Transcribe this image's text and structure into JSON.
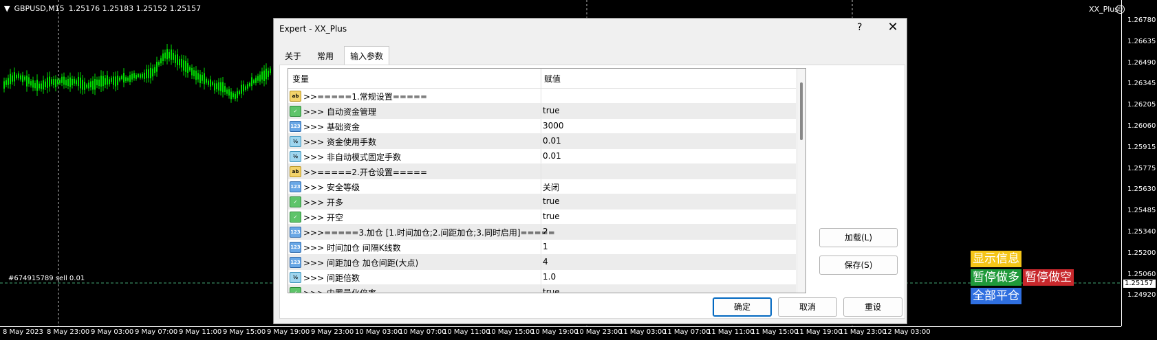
{
  "chart": {
    "symbol": "GBPUSD,M15",
    "ohlc": "1.25176 1.25183 1.25152 1.25157",
    "ea_name": "XX_Plus",
    "order_label": "#674915789 sell 0.01",
    "current_price": "1.25157",
    "price_ticks": [
      "1.26780",
      "1.26635",
      "1.26490",
      "1.26345",
      "1.26205",
      "1.26060",
      "1.25915",
      "1.25775",
      "1.25630",
      "1.25485",
      "1.25340",
      "1.25200",
      "1.25060",
      "1.24920"
    ],
    "time_ticks": [
      "8 May 2023",
      "8 May 23:00",
      "9 May 03:00",
      "9 May 07:00",
      "9 May 11:00",
      "9 May 15:00",
      "9 May 19:00",
      "9 May 23:00",
      "10 May 03:00",
      "10 May 07:00",
      "10 May 11:00",
      "10 May 15:00",
      "10 May 19:00",
      "10 May 23:00",
      "11 May 03:00",
      "11 May 07:00",
      "11 May 11:00",
      "11 May 15:00",
      "11 May 19:00",
      "11 May 23:00",
      "12 May 03:00"
    ],
    "candle_color": "#00e000"
  },
  "panel": {
    "show_info": "显示信息",
    "pause_buy": "暂停做多",
    "pause_sell": "暂停做空",
    "close_all": "全部平仓",
    "colors": {
      "show_info": "#f5c518",
      "pause_buy": "#1f9a3a",
      "pause_sell": "#c8282c",
      "close_all": "#2f6fe0"
    }
  },
  "dialog": {
    "title": "Expert - XX_Plus",
    "help": "?",
    "close": "✕",
    "tabs": [
      "关于",
      "常用",
      "输入参数"
    ],
    "columns": {
      "name": "变量",
      "value": "赋值"
    },
    "rows": [
      {
        "icon": "ab",
        "name": ">>=====1.常规设置=====",
        "value": ""
      },
      {
        "icon": "bool",
        "name": ">>>  自动资金管理",
        "value": "true"
      },
      {
        "icon": "int",
        "name": ">>>  基础资金",
        "value": "3000"
      },
      {
        "icon": "dbl",
        "name": ">>>  资金使用手数",
        "value": "0.01"
      },
      {
        "icon": "dbl",
        "name": ">>>  非自动模式固定手数",
        "value": "0.01"
      },
      {
        "icon": "ab",
        "name": ">>=====2.开仓设置=====",
        "value": ""
      },
      {
        "icon": "int",
        "name": ">>>  安全等级",
        "value": "关闭"
      },
      {
        "icon": "bool",
        "name": ">>>  开多",
        "value": "true"
      },
      {
        "icon": "bool",
        "name": ">>>  开空",
        "value": "true"
      },
      {
        "icon": "int",
        "name": ">>>=====3.加仓 [1.时间加仓;2.间距加仓;3.同时启用]=====",
        "value": "2"
      },
      {
        "icon": "int",
        "name": ">>>  时间加仓 间隔K线数",
        "value": "1"
      },
      {
        "icon": "int",
        "name": ">>>  间距加仓 加仓间距(大点)",
        "value": "4"
      },
      {
        "icon": "dbl",
        "name": ">>>  间距倍数",
        "value": "1.0"
      },
      {
        "icon": "bool",
        "name": ">>>  内置量化倍率",
        "value": "true"
      }
    ],
    "buttons": {
      "load": "加载(L)",
      "save": "保存(S)",
      "ok": "确定",
      "cancel": "取消",
      "reset": "重设"
    }
  }
}
